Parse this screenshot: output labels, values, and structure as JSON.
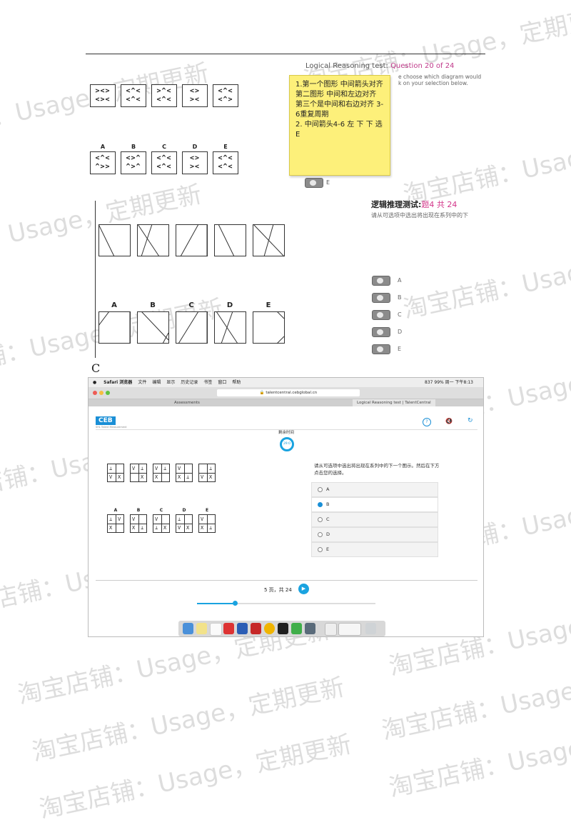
{
  "panel1": {
    "title_prefix": "Logical Reasoning test: ",
    "question_label": "Question 20 of 24",
    "instruction_line1": "e choose which diagram would",
    "instruction_line2": "k on your selection below.",
    "sequence_cells": [
      [
        "><>",
        "<><"
      ],
      [
        "<^<",
        "<^<"
      ],
      [
        ">^<",
        "<^<"
      ],
      [
        "<>",
        "><"
      ],
      [
        "<^<",
        "<^>"
      ]
    ],
    "option_labels": [
      "A",
      "B",
      "C",
      "D",
      "E"
    ],
    "option_cells": [
      [
        "<^<",
        "^>>"
      ],
      [
        "<>^",
        "^>^"
      ],
      [
        "<^<",
        "<^<"
      ],
      [
        "<>",
        "><"
      ],
      [
        "<^<",
        "<^<"
      ]
    ],
    "note_text": "1.第一个图形 中间箭头对齐 第二图形 中间和左边对齐 第三个是中间和右边对齐 3-6重复周期\n2. 中间箭头4-6 左 下 下 选E",
    "selected_label": "E"
  },
  "panel2": {
    "title_prefix": "逻辑推理测试:",
    "title_num": "题4 共 24",
    "subtitle": "请从可选项中选出将出现在系列中的下",
    "option_labels": [
      "A",
      "B",
      "C",
      "D",
      "E"
    ],
    "radio_labels": [
      "A",
      "B",
      "C",
      "D",
      "E"
    ],
    "answer_letter": "C"
  },
  "panel3": {
    "menubar_items": [
      "Safari 浏览器",
      "文件",
      "编辑",
      "显示",
      "历史记录",
      "书签",
      "窗口",
      "帮助"
    ],
    "menubar_right": "837   99%   周一 下午8:13",
    "url": "talentcentral.cebglobal.cn",
    "tab1": "Assessments",
    "tab2": "Logical Reasoning test | TalentCentral",
    "logo": "CEB",
    "logo_sub": "SHL Talent Measurement",
    "timer_label": "剩余时间",
    "timer_value": "29:0",
    "question": "请从可选项中选出将出现在系列中的下一个图示。然后在下方点击您的选择。",
    "options": [
      "A",
      "B",
      "C",
      "D",
      "E"
    ],
    "selected_option": "B",
    "option_letters": [
      "A",
      "B",
      "C",
      "D",
      "E"
    ],
    "pager": "5 页，共 24",
    "progress_fraction": 0.21,
    "accent": "#1aa3e0"
  },
  "watermark": {
    "text_full": "淘宝店铺：Usage，定期更新"
  }
}
